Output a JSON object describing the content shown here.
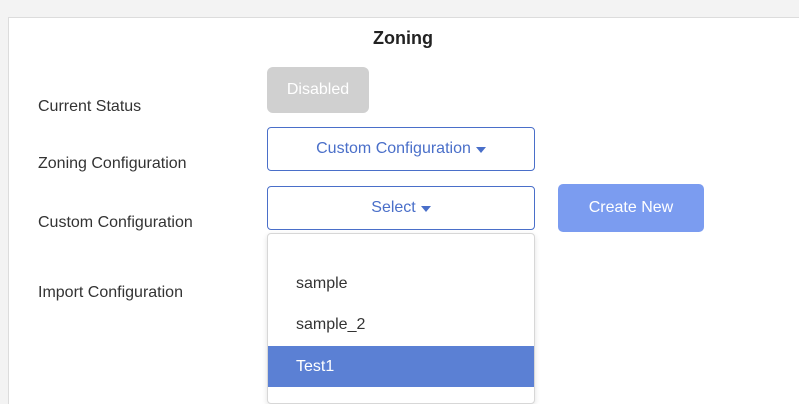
{
  "panel": {
    "title": "Zoning"
  },
  "rows": {
    "current_status": {
      "label": "Current Status",
      "value": "Disabled"
    },
    "zoning_config": {
      "label": "Zoning Configuration",
      "selected": "Custom Configuration"
    },
    "custom_config": {
      "label": "Custom Configuration",
      "selected": "Select",
      "create_label": "Create New"
    },
    "import_config": {
      "label": "Import Configuration"
    }
  },
  "dropdown": {
    "items": [
      "sample",
      "sample_2",
      "Test1"
    ],
    "active_index": 2
  },
  "colors": {
    "accent": "#4a6fc9",
    "button": "#7b9cf0",
    "active_item": "#5b80d4",
    "disabled": "#d0d0d0"
  }
}
